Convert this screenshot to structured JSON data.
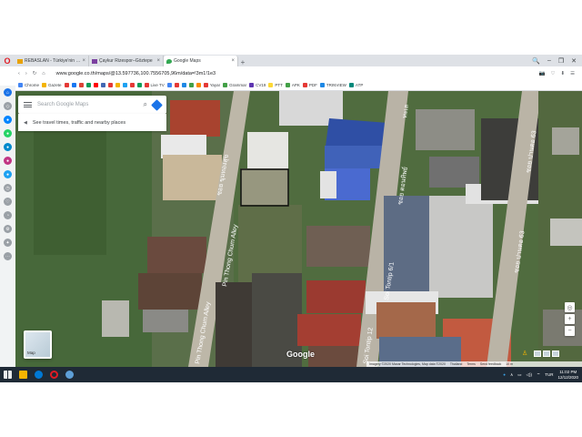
{
  "browser": {
    "logo_glyph": "O",
    "tabs": [
      {
        "label": "REBASLAN - Türkiye'nin e...",
        "favicon_color": "#e8a200",
        "active": false
      },
      {
        "label": "Çaykur Rizespor–Göztepe",
        "favicon_color": "#7b3fa0",
        "active": false
      },
      {
        "label": "Google Maps",
        "favicon_color": "#34a853",
        "active": true
      }
    ],
    "close_glyph": "×",
    "new_tab_glyph": "+",
    "window_controls": [
      "🔍",
      "–",
      "❐",
      "✕"
    ],
    "nav": {
      "back": "‹",
      "forward": "›",
      "reload": "↻",
      "home": "⌂"
    },
    "url_host": "www.google.co.th",
    "url_path": "/maps/@13.597736,100.7556705,96m/data=!3m1!1e3",
    "addr_icons": [
      "📷",
      "♡",
      "⬇",
      "☰"
    ]
  },
  "bookmarks": [
    {
      "label": "Chrome",
      "color": "#4285f4"
    },
    {
      "label": "Gazete",
      "color": "#f4b400"
    },
    {
      "label": "",
      "color": "#e53935"
    },
    {
      "label": "",
      "color": "#1877f2"
    },
    {
      "label": "",
      "color": "#db4437"
    },
    {
      "label": "",
      "color": "#0f9d58"
    },
    {
      "label": "",
      "color": "#ff0000"
    },
    {
      "label": "",
      "color": "#4267b2"
    },
    {
      "label": "",
      "color": "#e53935"
    },
    {
      "label": "",
      "color": "#f4b400"
    },
    {
      "label": "",
      "color": "#1da1f2"
    },
    {
      "label": "",
      "color": "#e53935"
    },
    {
      "label": "",
      "color": "#0f9d58"
    },
    {
      "label": "Live TV",
      "color": "#e53935"
    },
    {
      "label": "",
      "color": "#4285f4"
    },
    {
      "label": "",
      "color": "#e53935"
    },
    {
      "label": "",
      "color": "#1e88e5"
    },
    {
      "label": "",
      "color": "#43a047"
    },
    {
      "label": "",
      "color": "#fb8c00"
    },
    {
      "label": "Yayar",
      "color": "#e53935"
    },
    {
      "label": "Grammar",
      "color": "#43a047"
    },
    {
      "label": "CV19",
      "color": "#5e35b1"
    },
    {
      "label": "PTT",
      "color": "#fdd835"
    },
    {
      "label": "APK",
      "color": "#43a047"
    },
    {
      "label": "PDF",
      "color": "#e53935"
    },
    {
      "label": "TRINVIEW",
      "color": "#1e88e5"
    },
    {
      "label": "ATP",
      "color": "#00897b"
    }
  ],
  "sidebar_icons": [
    {
      "name": "home-icon",
      "color": "#1a73e8",
      "glyph": "⌂"
    },
    {
      "name": "shield-icon",
      "color": "#9aa0a6",
      "glyph": "◇"
    },
    {
      "name": "messenger-icon",
      "color": "#0084ff",
      "glyph": "●"
    },
    {
      "name": "whatsapp-icon",
      "color": "#25d366",
      "glyph": "●"
    },
    {
      "name": "telegram-icon",
      "color": "#0088cc",
      "glyph": "●"
    },
    {
      "name": "instagram-icon",
      "color": "#c13584",
      "glyph": "●"
    },
    {
      "name": "vk-icon",
      "color": "#1da1f2",
      "glyph": "●"
    },
    {
      "name": "history-icon",
      "color": "#9aa0a6",
      "glyph": "◷"
    },
    {
      "name": "heart-icon",
      "color": "#9aa0a6",
      "glyph": "♡"
    },
    {
      "name": "clock-icon",
      "color": "#9aa0a6",
      "glyph": "◔"
    },
    {
      "name": "settings-icon",
      "color": "#9aa0a6",
      "glyph": "⚙"
    },
    {
      "name": "bulb-icon",
      "color": "#9aa0a6",
      "glyph": "✦"
    },
    {
      "name": "more-icon",
      "color": "#9aa0a6",
      "glyph": "⋯"
    }
  ],
  "maps": {
    "search_placeholder": "Search Google Maps",
    "search_glyph": "⌕",
    "travel_text": "See travel times, traffic and nearby places",
    "travel_glyph": "◀",
    "layers_label": "Map",
    "logo_text": "Google",
    "road_labels": [
      "ซอย ขุมทองสุข",
      "Pin Thong Chum Alley",
      "Pin Thong Chum Alley",
      "ซอย ตอนทิพย์",
      "Soi Tontip 6/1",
      "Soi Tontip 12",
      "ซอย ปานตอ 63",
      "ซอย ปานตอ 63",
      "ทะเล"
    ],
    "zoom_in": "+",
    "zoom_out": "−",
    "compass": "◎",
    "pegman_glyph": "♙",
    "footer": [
      "Imagery ©2020 Maxar Technologies, Map data ©2020",
      "Thailand",
      "Terms",
      "Send feedback",
      "10 m"
    ],
    "accent": "#1a73e8"
  },
  "taskbar": {
    "icons": [
      {
        "name": "windows-start-icon",
        "color": "#ffffff"
      },
      {
        "name": "search-icon",
        "color": "#ffffff"
      },
      {
        "name": "file-explorer-icon",
        "color": "#f4b400"
      },
      {
        "name": "edge-icon",
        "color": "#0078d4"
      },
      {
        "name": "opera-icon",
        "color": "#e01b24"
      },
      {
        "name": "photos-icon",
        "color": "#5e9fd7"
      }
    ],
    "lang": "TUR",
    "time": "11:02 PM",
    "date": "12/12/2020",
    "tray_glyphs": [
      "●",
      "∧",
      "▭",
      "◁))",
      "⌔"
    ]
  }
}
